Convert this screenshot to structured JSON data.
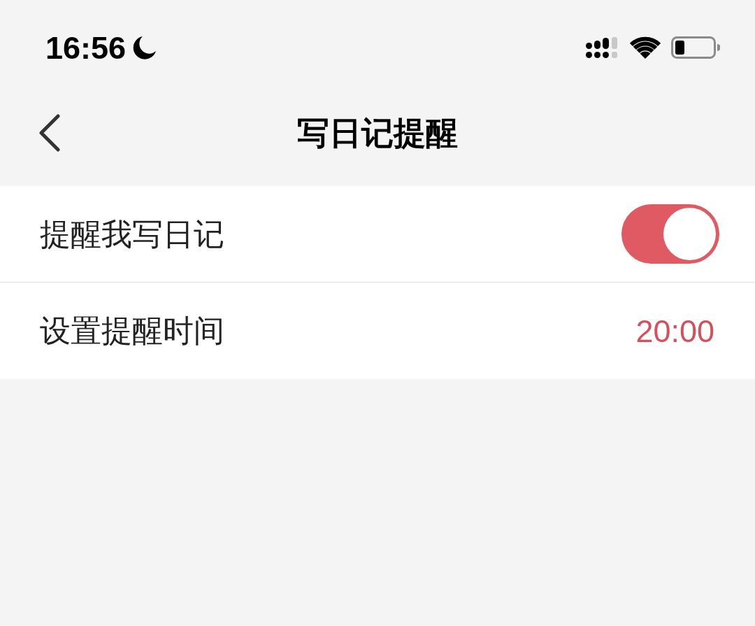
{
  "status_bar": {
    "time": "16:56"
  },
  "nav_bar": {
    "title": "写日记提醒"
  },
  "settings": [
    {
      "kind": "toggle",
      "label": "提醒我写日记",
      "on": true
    },
    {
      "kind": "value",
      "label": "设置提醒时间",
      "value": "20:00"
    }
  ]
}
